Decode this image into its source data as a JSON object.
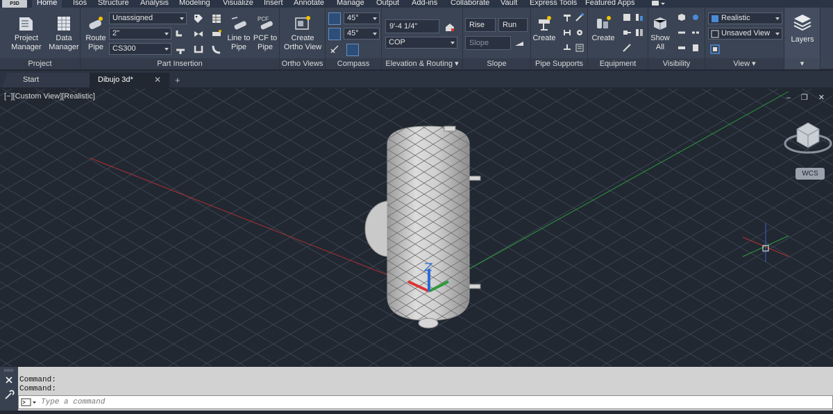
{
  "app": {
    "button_label": "P3D"
  },
  "menu_tabs": [
    "Home",
    "Isos",
    "Structure",
    "Analysis",
    "Modeling",
    "Visualize",
    "Insert",
    "Annotate",
    "Manage",
    "Output",
    "Add-ins",
    "Collaborate",
    "Vault",
    "Express Tools",
    "Featured Apps"
  ],
  "ribbon": {
    "project": {
      "title": "Project",
      "project_manager": "Project\nManager",
      "data_manager": "Data\nManager"
    },
    "part_insertion": {
      "title": "Part Insertion",
      "route_pipe": "Route\nPipe",
      "service": "Unassigned",
      "size": "2\"",
      "spec": "CS300",
      "line_to_pipe": "Line to\nPipe",
      "pcf_to_pipe": "PCF to\nPipe",
      "pcf_label": "PCF"
    },
    "ortho_views": {
      "title": "Ortho Views",
      "create_ortho_view": "Create\nOrtho View"
    },
    "compass": {
      "title": "Compass",
      "angle1": "45°",
      "angle2": "45°"
    },
    "elevation_routing": {
      "title": "Elevation & Routing",
      "elevation": "9'-4 1/4\"",
      "reference": "COP"
    },
    "slope": {
      "title": "Slope",
      "rise": "Rise",
      "run": "Run",
      "slope_placeholder": "Slope"
    },
    "pipe_supports": {
      "title": "Pipe Supports",
      "create": "Create"
    },
    "equipment": {
      "title": "Equipment",
      "create": "Create"
    },
    "visibility": {
      "title": "Visibility",
      "show_all": "Show\nAll"
    },
    "view": {
      "title": "View",
      "visual_style": "Realistic",
      "named_view": "Unsaved View"
    },
    "layers": {
      "title": "Layers"
    }
  },
  "doc_tabs": {
    "start": "Start",
    "active": "Dibujo 3d*",
    "close": "✕",
    "add": "+"
  },
  "viewport": {
    "label": "[−][Custom View][Realistic]",
    "wcs": "WCS",
    "controls": "‒ ❐ ✕"
  },
  "command": {
    "line1": "Command:",
    "line2": "Command:",
    "placeholder": "Type a command"
  },
  "colors": {
    "background": "#212832",
    "ribbon": "#3b4454",
    "x_axis": "#b03030",
    "y_axis": "#2f9a3a",
    "z_axis": "#2a6bd6"
  }
}
